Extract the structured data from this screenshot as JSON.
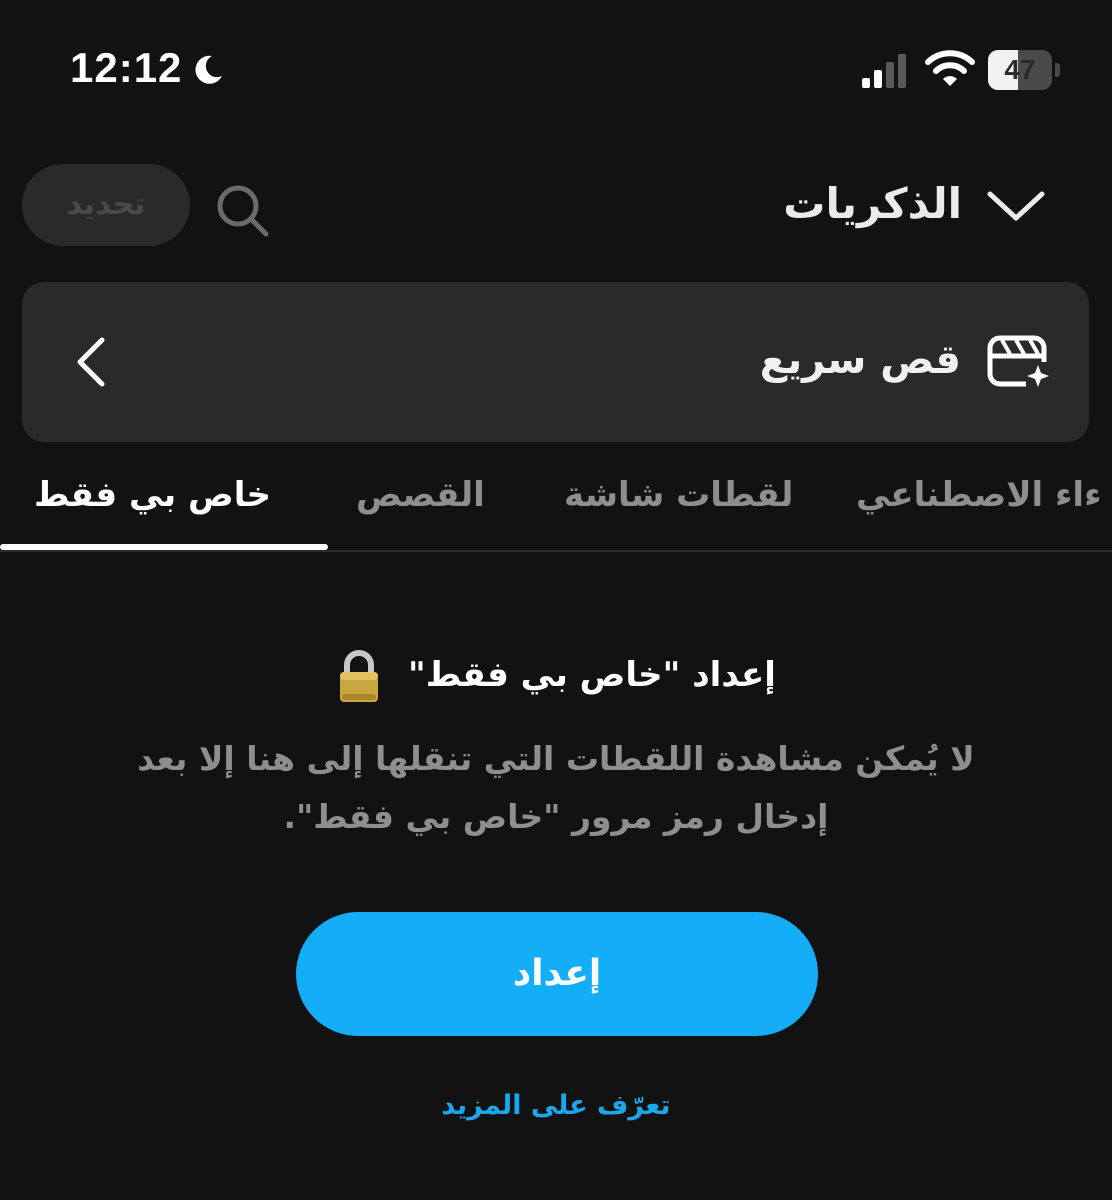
{
  "status_bar": {
    "time": "12:12",
    "battery_level": "47",
    "battery_fraction": 0.47
  },
  "header": {
    "title": "الذكريات",
    "update_label": "تحديد"
  },
  "quick_cut": {
    "label": "قص سريع"
  },
  "tabs": [
    {
      "label": "خاص بي فقط",
      "active": true
    },
    {
      "label": "القصص",
      "active": false
    },
    {
      "label": "لقطات شاشة",
      "active": false
    },
    {
      "label": "ءاء الاصطناعي",
      "active": false
    }
  ],
  "content": {
    "title": "إعداد \"خاص بي فقط\"",
    "description_line1": "لا يُمكن مشاهدة اللقطات التي تنقلها إلى هنا إلا بعد",
    "description_line2": "إدخال رمز مرور \"خاص بي فقط\".",
    "setup_button": "إعداد",
    "learn_more": "تعرّف على المزيد"
  },
  "colors": {
    "background": "#121212",
    "card": "#2a2a2a",
    "accent": "#14aef8",
    "muted_text": "#8e8e8e",
    "link": "#1aa7ec"
  },
  "icons": {
    "status": [
      "moon-icon",
      "signal-icon",
      "wifi-icon",
      "battery-icon"
    ],
    "header": [
      "search-icon",
      "chevron-down-icon"
    ],
    "card": [
      "quick-cut-icon",
      "chevron-left-icon"
    ],
    "content": [
      "lock-icon"
    ]
  }
}
